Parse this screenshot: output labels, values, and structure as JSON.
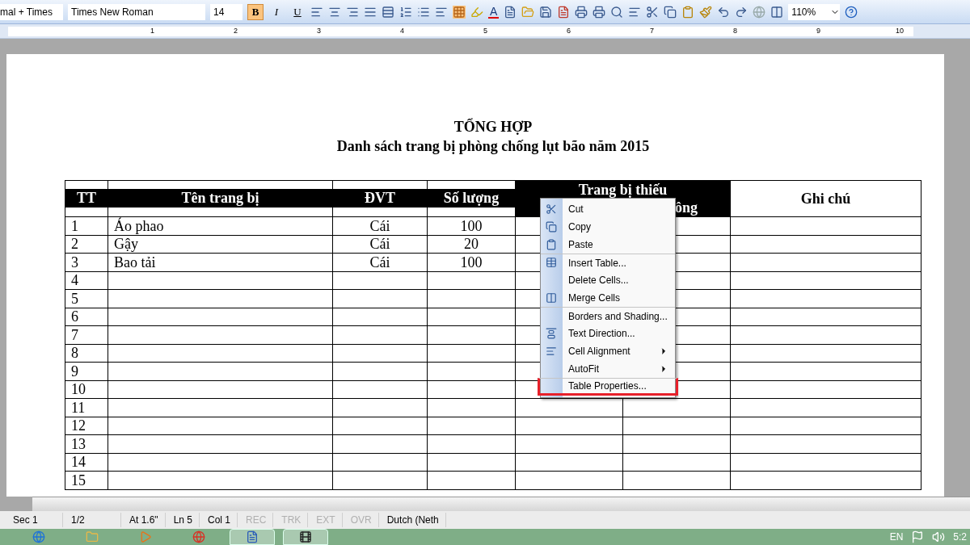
{
  "toolbar": {
    "style": "mal + Times",
    "font": "Times New Roman",
    "size": "14",
    "format_buttons": [
      {
        "label": "B",
        "selected": true
      },
      {
        "label": "I",
        "selected": false
      },
      {
        "label": "U",
        "selected": false
      }
    ],
    "font_color_label": "A",
    "zoom": "110%"
  },
  "ruler": {
    "numbers": [
      "1",
      "2",
      "3",
      "4",
      "5",
      "6",
      "7",
      "8",
      "9",
      "10"
    ]
  },
  "document": {
    "title": "TỔNG HỢP",
    "subtitle": "Danh sách trang bị phòng chống lụt bão năm 2015",
    "table": {
      "columns": [
        {
          "label": "TT",
          "kind": "band"
        },
        {
          "label": "Tên trang bị",
          "kind": "band"
        },
        {
          "label": "ĐVT",
          "kind": "band"
        },
        {
          "label": "Số lượng",
          "kind": "band"
        },
        {
          "label": "Trang bị thiếu",
          "label_2": "ông",
          "kind": "merged"
        },
        {
          "label": "Ghi chú",
          "kind": "plain"
        }
      ],
      "rows": [
        [
          "1",
          "Áo phao",
          "Cái",
          "100"
        ],
        [
          "2",
          "Gậy",
          "Cái",
          "20"
        ],
        [
          "3",
          "Bao tải",
          "Cái",
          "100"
        ],
        [
          "4"
        ],
        [
          "5"
        ],
        [
          "6"
        ],
        [
          "7"
        ],
        [
          "8"
        ],
        [
          "9"
        ],
        [
          "10"
        ],
        [
          "11"
        ],
        [
          "12"
        ],
        [
          "13"
        ],
        [
          "14"
        ],
        [
          "15"
        ]
      ]
    }
  },
  "context_menu": [
    {
      "label": "Cut",
      "separator_before": false,
      "submenu": false,
      "highlighted": false
    },
    {
      "label": "Copy",
      "separator_before": false,
      "submenu": false,
      "highlighted": false
    },
    {
      "label": "Paste",
      "separator_before": false,
      "submenu": false,
      "highlighted": false
    },
    {
      "label": "Insert Table...",
      "separator_before": true,
      "submenu": false,
      "highlighted": false
    },
    {
      "label": "Delete Cells...",
      "separator_before": false,
      "submenu": false,
      "highlighted": false
    },
    {
      "label": "Merge Cells",
      "separator_before": false,
      "submenu": false,
      "highlighted": false
    },
    {
      "label": "Borders and Shading...",
      "separator_before": true,
      "submenu": false,
      "highlighted": false
    },
    {
      "label": "Text Direction...",
      "separator_before": false,
      "submenu": false,
      "highlighted": false
    },
    {
      "label": "Cell Alignment",
      "separator_before": false,
      "submenu": true,
      "highlighted": false
    },
    {
      "label": "AutoFit",
      "separator_before": false,
      "submenu": true,
      "highlighted": false
    },
    {
      "label": "Table Properties...",
      "separator_before": true,
      "submenu": false,
      "highlighted": true
    }
  ],
  "status_bar": [
    {
      "label": "Sec 1",
      "disabled": false
    },
    {
      "label": "1/2",
      "disabled": false
    },
    {
      "label": "At 1.6\"",
      "disabled": false
    },
    {
      "label": "Ln 5",
      "disabled": false
    },
    {
      "label": "Col 1",
      "disabled": false
    },
    {
      "label": "REC",
      "disabled": true
    },
    {
      "label": "TRK",
      "disabled": true
    },
    {
      "label": "EXT",
      "disabled": true
    },
    {
      "label": "OVR",
      "disabled": true
    },
    {
      "label": "Dutch (Neth",
      "disabled": false
    }
  ],
  "taskbar": {
    "apps": [
      {
        "selected": false
      },
      {
        "selected": false
      },
      {
        "selected": false
      },
      {
        "selected": false
      },
      {
        "selected": true
      },
      {
        "selected": true
      }
    ],
    "language": "EN",
    "clock": "5:2"
  }
}
